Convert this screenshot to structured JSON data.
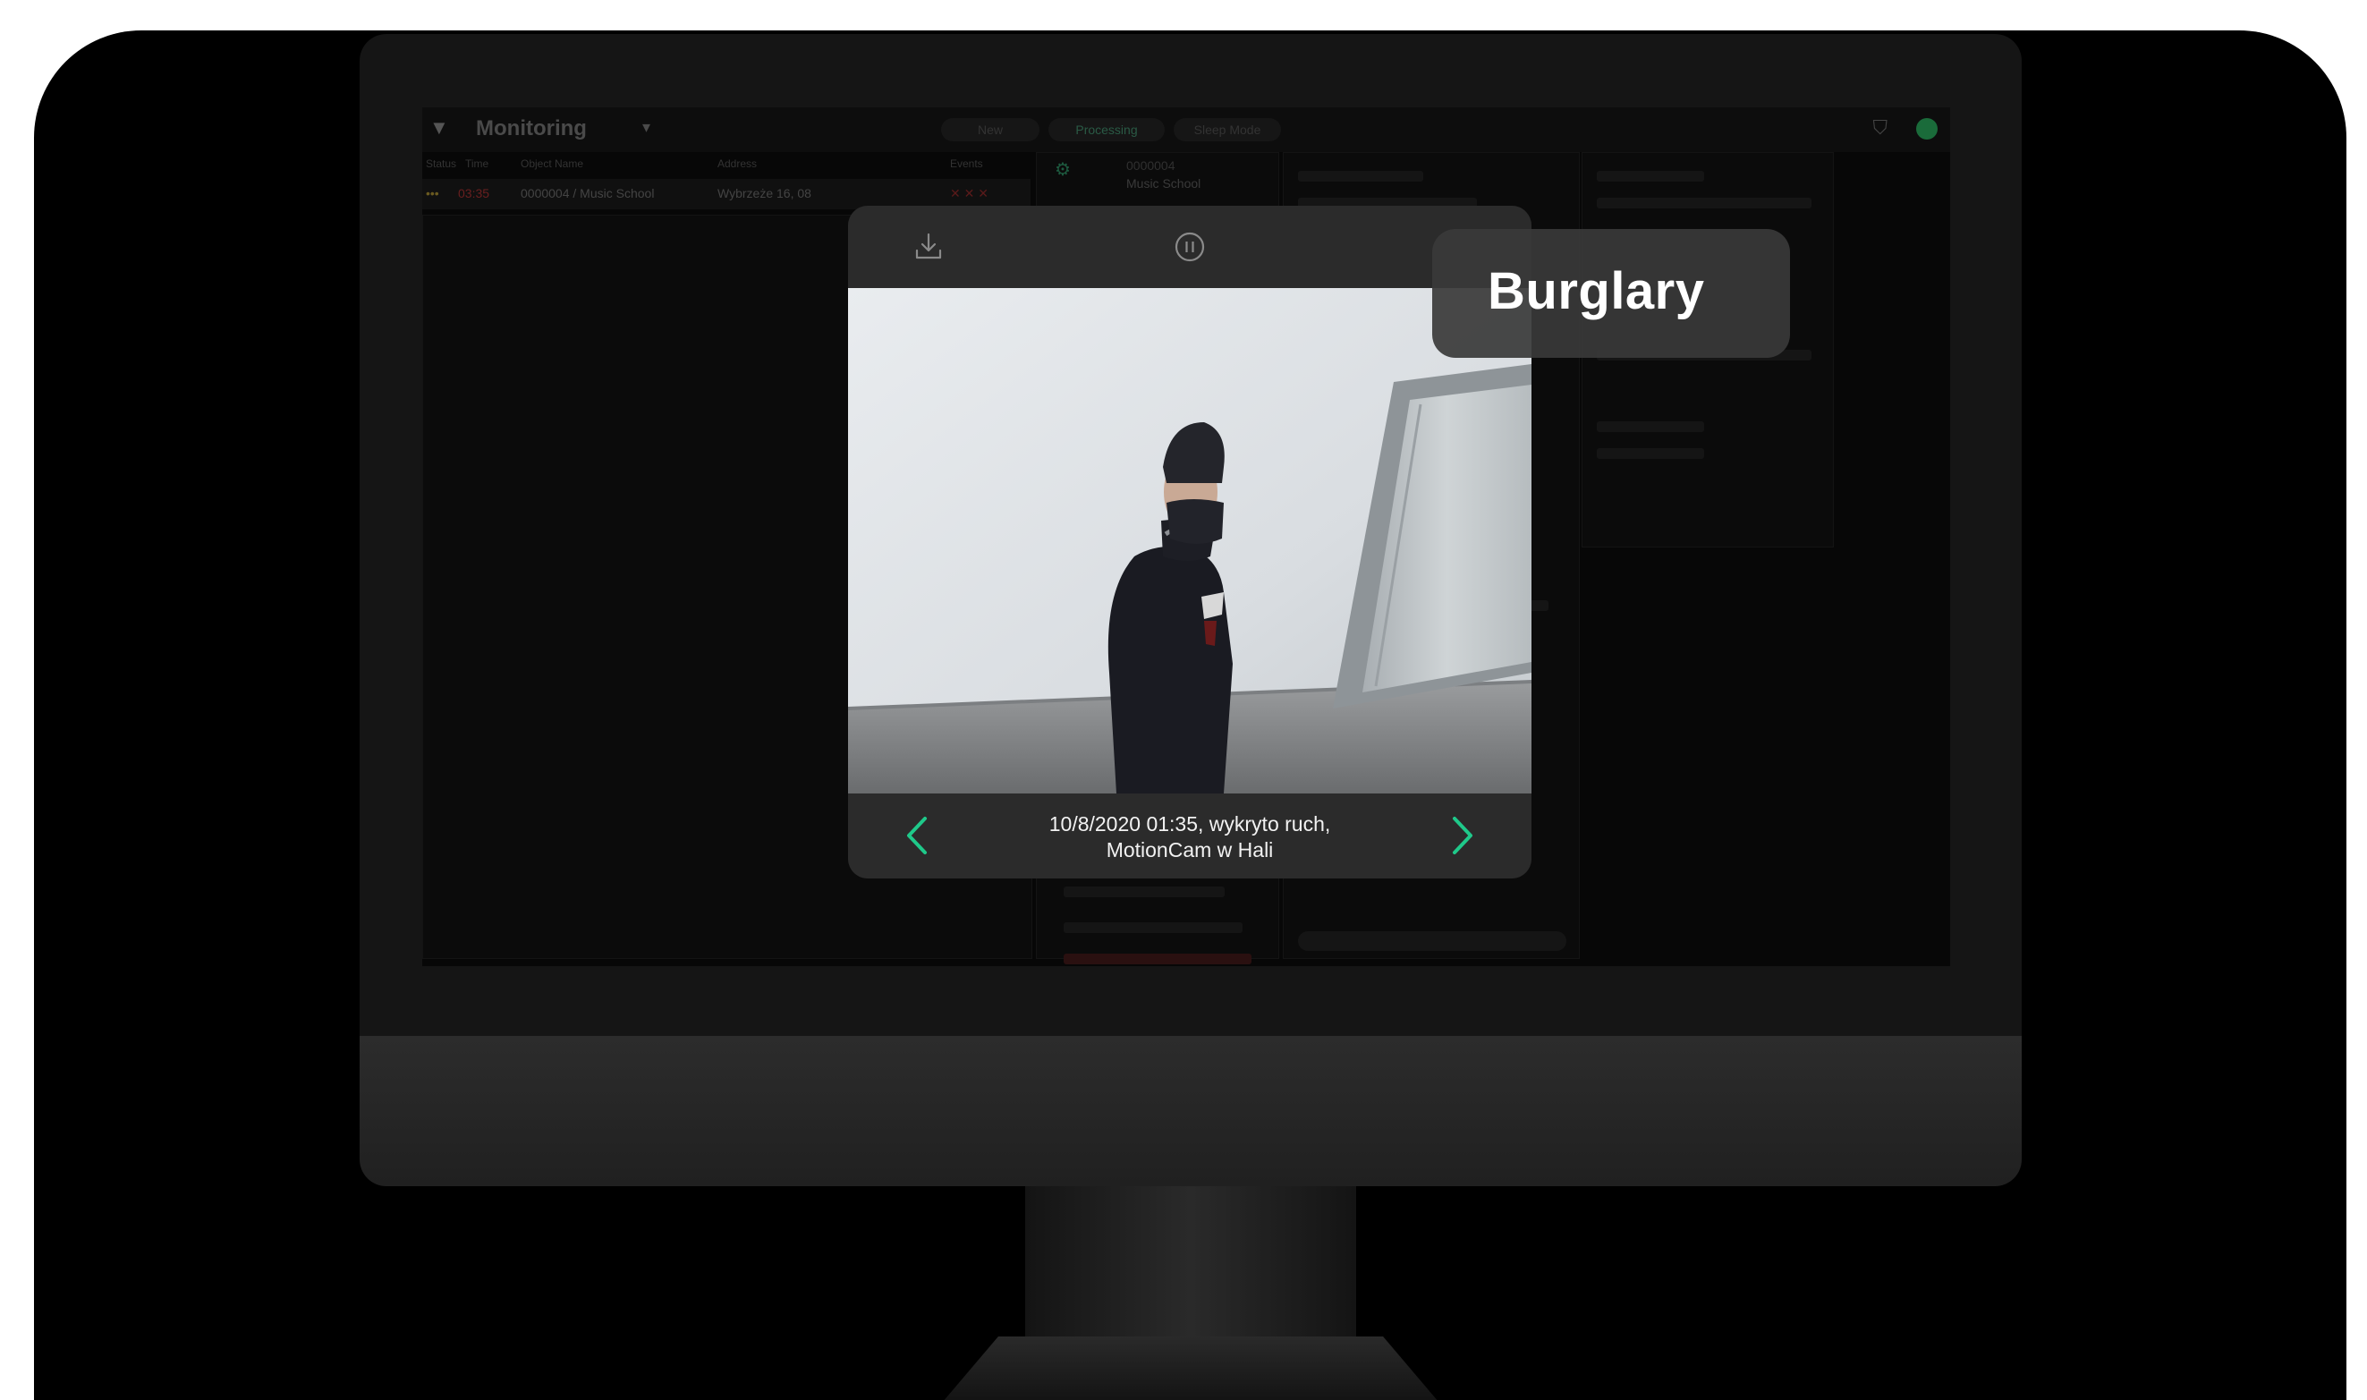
{
  "app": {
    "title": "Monitoring",
    "tabs": [
      "New",
      "Processing",
      "Sleep Mode"
    ],
    "columns": [
      "Status",
      "Time",
      "Object Name",
      "Address",
      "Events"
    ],
    "row": {
      "time": "03:35",
      "object": "0000004 / Music School",
      "address": "Wybrzeże 16, 08"
    },
    "hub_id": "0000004",
    "site_name": "Music School"
  },
  "modal": {
    "caption_line1": "10/8/2020 01:35, wykryto ruch,",
    "caption_line2": "MotionCam w Hali"
  },
  "badge": {
    "label": "Burglary"
  },
  "colors": {
    "accent": "#1fc98a",
    "status_ok": "#1a6b3a",
    "alarm_red": "#8a1c1c"
  },
  "icons": {
    "download": "download-icon",
    "pause": "pause-icon",
    "prev": "chevron-left-icon",
    "next": "chevron-right-icon"
  }
}
